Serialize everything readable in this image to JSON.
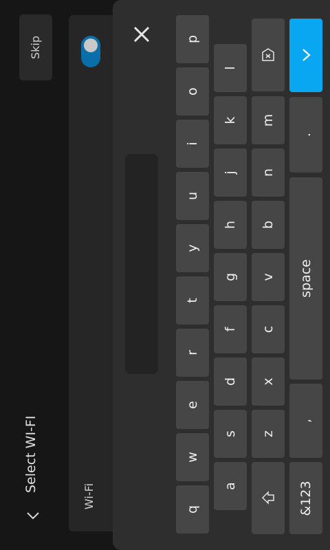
{
  "screen": {
    "title": "Select WI-FI",
    "skip_label": "Skip",
    "wifi_label": "Wi-Fi",
    "wifi_enabled": true
  },
  "keyboard": {
    "row1": [
      "q",
      "w",
      "e",
      "r",
      "t",
      "y",
      "u",
      "i",
      "o",
      "p"
    ],
    "row2": [
      "a",
      "s",
      "d",
      "f",
      "g",
      "h",
      "j",
      "k",
      "l"
    ],
    "row3": [
      "z",
      "x",
      "c",
      "v",
      "b",
      "n",
      "m"
    ],
    "bottom": {
      "symbols_label": "&123",
      "comma": ",",
      "space_label": "space",
      "period": "."
    },
    "colors": {
      "accent": "#09a6f2",
      "key": "#464646",
      "panel": "#2e2e2e"
    },
    "icons": {
      "close": "close-icon",
      "backspace": "backspace-icon",
      "shift": "shift-icon",
      "enter": "chevron-right-icon"
    }
  }
}
